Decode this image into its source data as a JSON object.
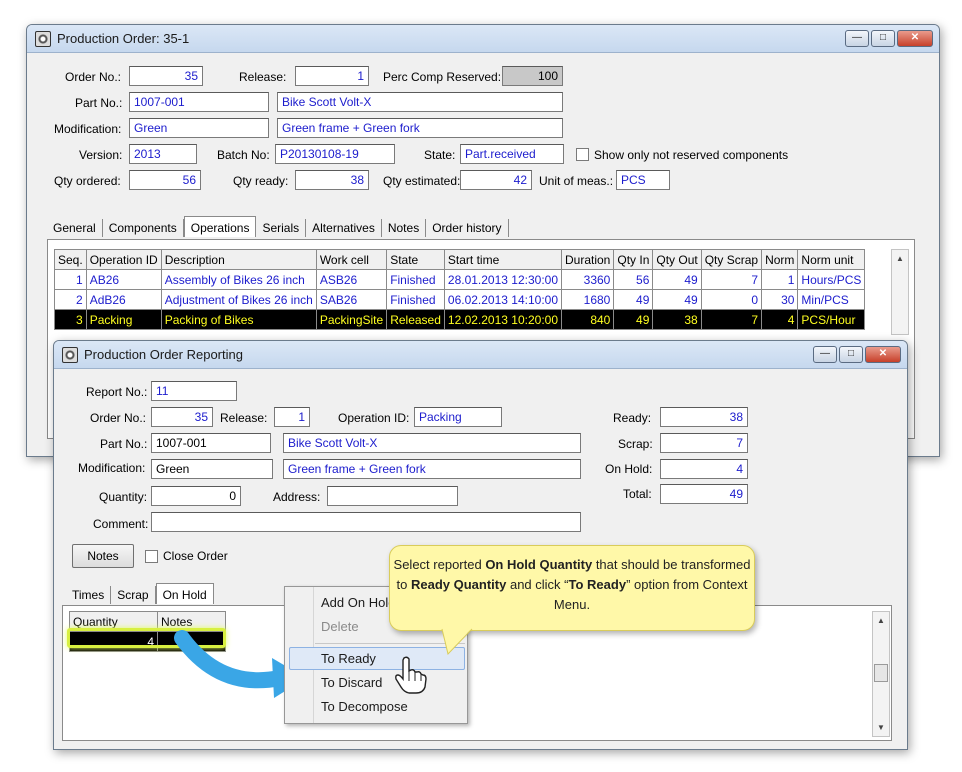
{
  "win1": {
    "title": "Production Order: 35-1",
    "labels": {
      "order_no": "Order No.:",
      "release": "Release:",
      "perc_comp": "Perc Comp Reserved:",
      "part_no": "Part No.:",
      "modification": "Modification:",
      "version": "Version:",
      "batch_no": "Batch No:",
      "state": "State:",
      "show_only": "Show only not reserved components",
      "qty_ordered": "Qty ordered:",
      "qty_ready": "Qty ready:",
      "qty_estimated": "Qty estimated:",
      "unit_of_meas": "Unit of meas.:"
    },
    "values": {
      "order_no": "35",
      "release": "1",
      "perc_comp": "100",
      "part_no": "1007-001",
      "part_desc": "Bike Scott Volt-X",
      "modification": "Green",
      "mod_desc": "Green frame + Green fork",
      "version": "2013",
      "batch_no": "P20130108-19",
      "state": "Part.received",
      "qty_ordered": "56",
      "qty_ready": "38",
      "qty_estimated": "42",
      "unit_of_meas": "PCS"
    },
    "tabs": [
      "General",
      "Components",
      "Operations",
      "Serials",
      "Alternatives",
      "Notes",
      "Order history"
    ],
    "grid": {
      "headers": [
        "Seq.",
        "Operation ID",
        "Description",
        "Work cell",
        "State",
        "Start time",
        "Duration",
        "Qty In",
        "Qty Out",
        "Qty Scrap",
        "Norm",
        "Norm unit"
      ],
      "rows": [
        [
          "1",
          "AB26",
          "Assembly of Bikes 26 inch",
          "ASB26",
          "Finished",
          "28.01.2013 12:30:00",
          "3360",
          "56",
          "49",
          "7",
          "1",
          "Hours/PCS"
        ],
        [
          "2",
          "AdB26",
          "Adjustment of Bikes 26 inch",
          "SAB26",
          "Finished",
          "06.02.2013 14:10:00",
          "1680",
          "49",
          "49",
          "0",
          "30",
          "Min/PCS"
        ],
        [
          "3",
          "Packing",
          "Packing of Bikes",
          "PackingSite",
          "Released",
          "12.02.2013 10:20:00",
          "840",
          "49",
          "38",
          "7",
          "4",
          "PCS/Hour"
        ]
      ]
    }
  },
  "win2": {
    "title": "Production Order Reporting",
    "labels": {
      "report_no": "Report No.:",
      "order_no": "Order No.:",
      "release": "Release:",
      "operation_id": "Operation ID:",
      "part_no": "Part No.:",
      "modification": "Modification:",
      "quantity": "Quantity:",
      "address": "Address:",
      "comment": "Comment:",
      "ready": "Ready:",
      "scrap": "Scrap:",
      "on_hold": "On Hold:",
      "total": "Total:",
      "close_order": "Close Order"
    },
    "values": {
      "report_no": "11",
      "order_no": "35",
      "release": "1",
      "operation_id": "Packing",
      "part_no": "1007-001",
      "part_desc": "Bike Scott Volt-X",
      "modification": "Green",
      "mod_desc": "Green frame + Green fork",
      "quantity": "0",
      "address": "",
      "comment": "",
      "ready": "38",
      "scrap": "7",
      "on_hold": "4",
      "total": "49"
    },
    "notes_button": "Notes",
    "tabs": [
      "Times",
      "Scrap",
      "On Hold"
    ],
    "grid": {
      "headers": [
        "Quantity",
        "Notes"
      ],
      "rows": [
        [
          "4",
          ""
        ]
      ]
    }
  },
  "context_menu": {
    "items": [
      "Add On Hold",
      "Delete",
      "To Ready",
      "To Discard",
      "To Decompose"
    ]
  },
  "callout": {
    "text_1": "Select reported ",
    "bold_1": "On Hold Quantity",
    "text_2": " that should be transformed to ",
    "bold_2": "Ready Quantity",
    "text_3": " and click “",
    "bold_3": "To Ready",
    "text_4": "” option from Context Menu."
  },
  "icons": [
    "app-icon",
    "minimize-icon",
    "maximize-icon",
    "close-icon",
    "hand-cursor-icon",
    "arrow-icon"
  ],
  "colors": {
    "value_text": "#1c1ccd",
    "selected_row_bg": "#000000",
    "selected_row_text": "#ffff20",
    "callout_bg": "#fff8a8",
    "highlight": "#d8f040",
    "arrow": "#3aa6e6"
  }
}
